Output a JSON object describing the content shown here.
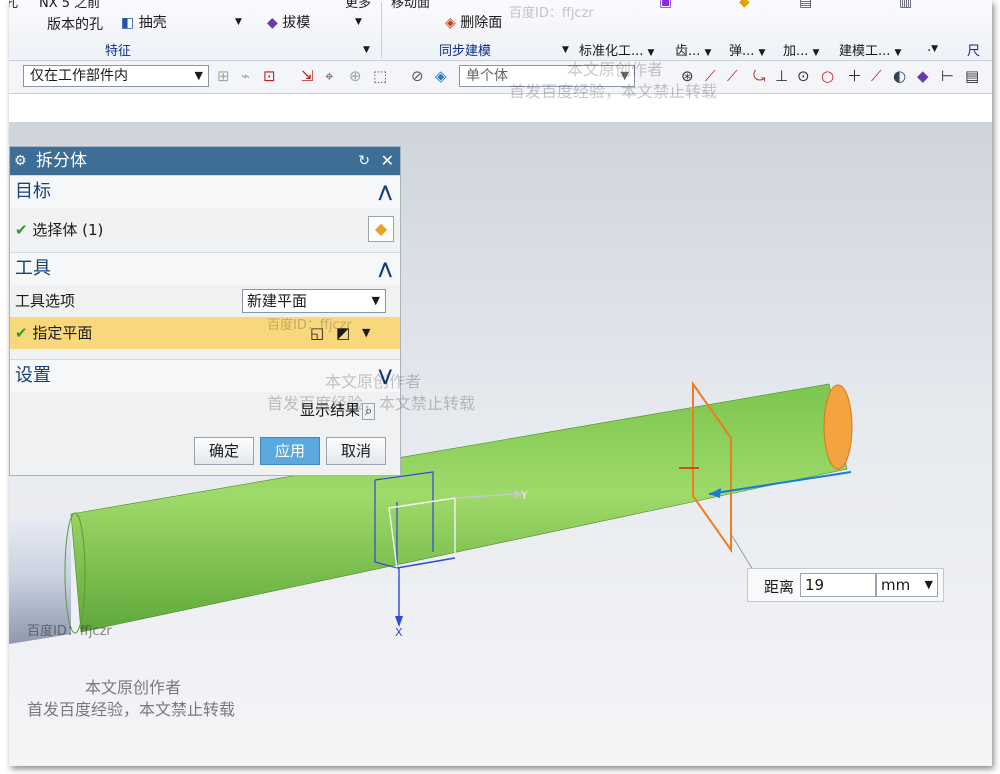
{
  "ribbon": {
    "top_labels": [
      "孔",
      "NX 5 之前",
      "更多",
      "移动面"
    ],
    "hole_label": "版本的孔",
    "shell_label": "抽壳",
    "draft_label": "拔模",
    "delete_face_label": "删除面",
    "group_feature": "特征",
    "group_sync": "同步建模",
    "dropdowns": [
      "标准化工...",
      "齿...",
      "弹...",
      "加...",
      "建模工...",
      ".",
      "尺寸"
    ]
  },
  "toolbar": {
    "scope_value": "仅在工作部件内",
    "body_value": "单个体"
  },
  "dialog": {
    "title": "拆分体",
    "target_section": "目标",
    "select_body": "选择体 (1)",
    "tool_section": "工具",
    "tool_option_label": "工具选项",
    "tool_option_value": "新建平面",
    "specify_plane": "指定平面",
    "settings_section": "设置",
    "show_result": "显示结果",
    "ok": "确定",
    "apply": "应用",
    "cancel": "取消"
  },
  "distance": {
    "label": "距离",
    "value": "19",
    "unit": "mm"
  },
  "axes": {
    "y": "Y",
    "x": "X"
  },
  "watermarks": {
    "id_prefix": "百度ID：",
    "id": "ffjczr",
    "line1": "本文原创作者",
    "line2": "首发百度经验，本文禁止转载"
  },
  "colors": {
    "title_bar": "#3d6e96",
    "highlight_row": "#f9d87c",
    "cylinder": "#8fd05e",
    "plane": "#f08a28"
  }
}
